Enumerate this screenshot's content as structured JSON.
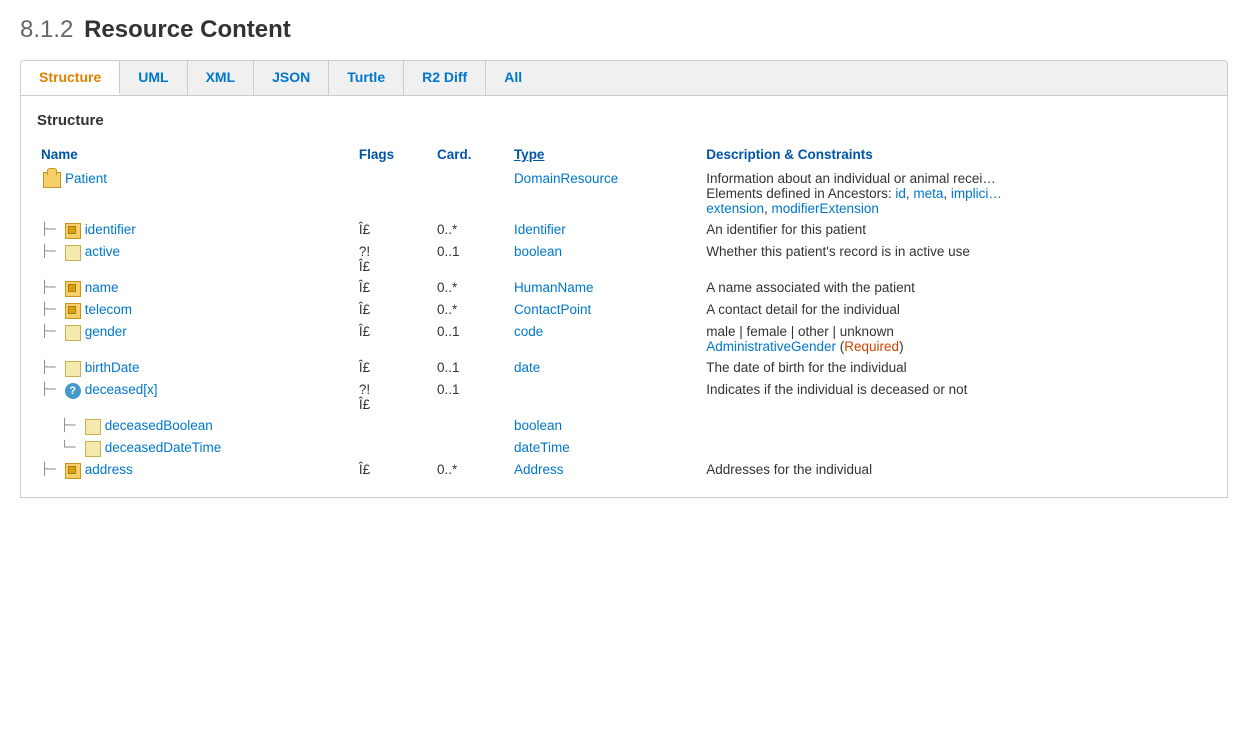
{
  "page": {
    "title_prefix": "8.1.2",
    "title": "Resource Content"
  },
  "tabs": [
    {
      "id": "structure",
      "label": "Structure",
      "active": true
    },
    {
      "id": "uml",
      "label": "UML",
      "active": false
    },
    {
      "id": "xml",
      "label": "XML",
      "active": false
    },
    {
      "id": "json",
      "label": "JSON",
      "active": false
    },
    {
      "id": "turtle",
      "label": "Turtle",
      "active": false
    },
    {
      "id": "r2diff",
      "label": "R2 Diff",
      "active": false
    },
    {
      "id": "all",
      "label": "All",
      "active": false
    }
  ],
  "structure_section": {
    "heading": "Structure"
  },
  "table": {
    "headers": [
      {
        "id": "name",
        "label": "Name",
        "underline": false
      },
      {
        "id": "flags",
        "label": "Flags",
        "underline": false
      },
      {
        "id": "card",
        "label": "Card.",
        "underline": false
      },
      {
        "id": "type",
        "label": "Type",
        "underline": true
      },
      {
        "id": "desc",
        "label": "Description & Constraints",
        "underline": false
      }
    ],
    "rows": [
      {
        "id": "patient",
        "indent": 0,
        "prefix": "",
        "icon": "root",
        "name": "Patient",
        "name_link": "",
        "flags": "",
        "card": "",
        "type": "DomainResource",
        "type_link": "#",
        "desc": "Information about an individual or animal recei… Elements defined in Ancestors: id, meta, implici… extension, modifierExtension",
        "desc_links": [
          "id",
          "meta",
          "implici…",
          "extension",
          "modifierExtension"
        ]
      },
      {
        "id": "identifier",
        "indent": 1,
        "prefix": "├─",
        "icon": "box",
        "name": "identifier",
        "flags": "Î£",
        "card": "0..*",
        "type": "Identifier",
        "type_link": "#",
        "desc": "An identifier for this patient"
      },
      {
        "id": "active",
        "indent": 1,
        "prefix": "├─",
        "icon": "field",
        "name": "active",
        "flags": "?!\nÎ£",
        "card": "0..1",
        "type": "boolean",
        "type_link": "#",
        "desc": "Whether this patient's record is in active use"
      },
      {
        "id": "name",
        "indent": 1,
        "prefix": "├─",
        "icon": "box",
        "name": "name",
        "flags": "Î£",
        "card": "0..*",
        "type": "HumanName",
        "type_link": "#",
        "desc": "A name associated with the patient"
      },
      {
        "id": "telecom",
        "indent": 1,
        "prefix": "├─",
        "icon": "box",
        "name": "telecom",
        "flags": "Î£",
        "card": "0..*",
        "type": "ContactPoint",
        "type_link": "#",
        "desc": "A contact detail for the individual"
      },
      {
        "id": "gender",
        "indent": 1,
        "prefix": "├─",
        "icon": "field",
        "name": "gender",
        "flags": "Î£",
        "card": "0..1",
        "type": "code",
        "type_link": "#",
        "desc": "male | female | other | unknown AdministrativeGender (Required)"
      },
      {
        "id": "birthDate",
        "indent": 1,
        "prefix": "├─",
        "icon": "field",
        "name": "birthDate",
        "flags": "Î£",
        "card": "0..1",
        "type": "date",
        "type_link": "#",
        "desc": "The date of birth for the individual"
      },
      {
        "id": "deceasedx",
        "indent": 1,
        "prefix": "├─",
        "icon": "question",
        "name": "deceased[x]",
        "flags": "?!\nÎ£",
        "card": "0..1",
        "type": "",
        "type_link": "",
        "desc": "Indicates if the individual is deceased or not"
      },
      {
        "id": "deceasedBoolean",
        "indent": 2,
        "prefix": "│  ├─",
        "icon": "field",
        "name": "deceasedBoolean",
        "flags": "",
        "card": "",
        "type": "boolean",
        "type_link": "#",
        "desc": ""
      },
      {
        "id": "deceasedDateTime",
        "indent": 2,
        "prefix": "│  └─",
        "icon": "field",
        "name": "deceasedDateTime",
        "flags": "",
        "card": "",
        "type": "dateTime",
        "type_link": "#",
        "desc": ""
      },
      {
        "id": "address",
        "indent": 1,
        "prefix": "├─",
        "icon": "box",
        "name": "address",
        "flags": "Î£",
        "card": "0..*",
        "type": "Address",
        "type_link": "#",
        "desc": "Addresses for the individual"
      }
    ]
  }
}
